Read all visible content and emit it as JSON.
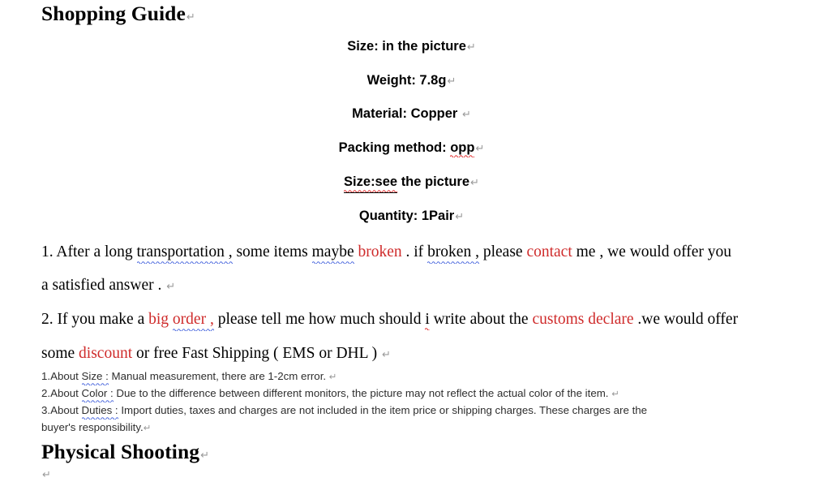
{
  "document": {
    "heading_main": "Shopping Guide",
    "heading_footer": "Physical Shooting",
    "pilcrow_glyph": "↵"
  },
  "specs": {
    "lines": [
      {
        "label": "Size:",
        "value": "in the picture",
        "full": "Size: in the picture",
        "spellcheck": "none"
      },
      {
        "label": "Weight:",
        "value": "7.8g",
        "full": "Weight: 7.8g",
        "spellcheck": "none"
      },
      {
        "label": "Material:",
        "value": "Copper",
        "full": "Material: Copper ",
        "spellcheck": "none"
      },
      {
        "label": "Packing method:",
        "value": "opp",
        "full": "Packing method: opp",
        "spellcheck": "red-wavy-on-opp"
      },
      {
        "label": "Size:see",
        "value": "the picture",
        "full": "Size:see the picture",
        "spellcheck": "red-wavy-underline-on-Size:see"
      },
      {
        "label": "Quantity:",
        "value": "1Pair",
        "full": "Quantity: 1Pair",
        "spellcheck": "none"
      }
    ]
  },
  "terms": {
    "item1": {
      "number": "1.",
      "seg_a": " After a long ",
      "seg_b": "transportation ,",
      "seg_c": " some items ",
      "seg_d": "maybe",
      "seg_e": " ",
      "seg_f": "broken",
      "seg_g": " . if ",
      "seg_h": "broken ,",
      "seg_i": " please ",
      "seg_j": "contact",
      "seg_k": " me , we would offer you",
      "line2": "a satisfied answer . "
    },
    "item2": {
      "number": "2.",
      "seg_a": " If you make a ",
      "seg_b": "big ",
      "seg_c": "order ,",
      "seg_d": " please tell me how much should ",
      "seg_e": "i",
      "seg_f": " write about the ",
      "seg_g": "customs declare",
      "seg_h": " .we would offer",
      "line2_a": "some ",
      "line2_b": "discount",
      "line2_c": " or free Fast Shipping ( EMS or DHL ) "
    }
  },
  "notes": {
    "note1": {
      "prefix": "1.About ",
      "topic": "Size :",
      "text": " Manual measurement, there are 1-2cm error.   "
    },
    "note2": {
      "prefix": "2.About ",
      "topic": "Color :",
      "text": " Due to the difference between different monitors, the picture may not reflect the actual color of the item.  "
    },
    "note3": {
      "prefix": "3.About ",
      "topic": "Duties :",
      "text": " Import duties, taxes and charges are not included in the item price or shipping charges. These charges are the",
      "text_line2": "buyer's responsibility."
    }
  },
  "colors": {
    "accent_red": "#cf2b2b",
    "spell_red": "#e01b1b",
    "grammar_blue": "#3b5bdb",
    "pilcrow_gray": "#9a9a9a",
    "note_text": "#2e2e2e"
  }
}
